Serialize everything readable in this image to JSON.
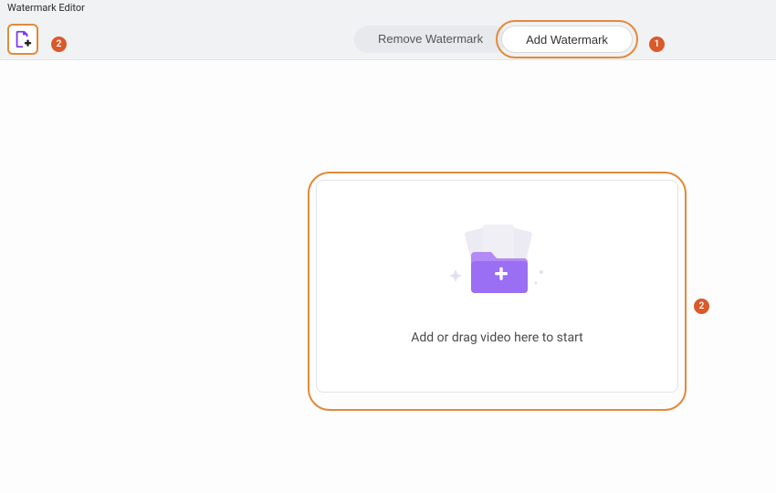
{
  "window": {
    "title": "Watermark Editor"
  },
  "toolbar": {
    "remove_label": "Remove Watermark",
    "add_label": "Add Watermark"
  },
  "dropzone": {
    "hint": "Add or drag video here to start"
  },
  "callouts": {
    "one": "1",
    "two_a": "2",
    "two_b": "2"
  },
  "colors": {
    "accent_ring": "#e28a3b",
    "badge": "#d95a2b",
    "folder_a": "#b38af6",
    "folder_b": "#8b5cf0"
  }
}
